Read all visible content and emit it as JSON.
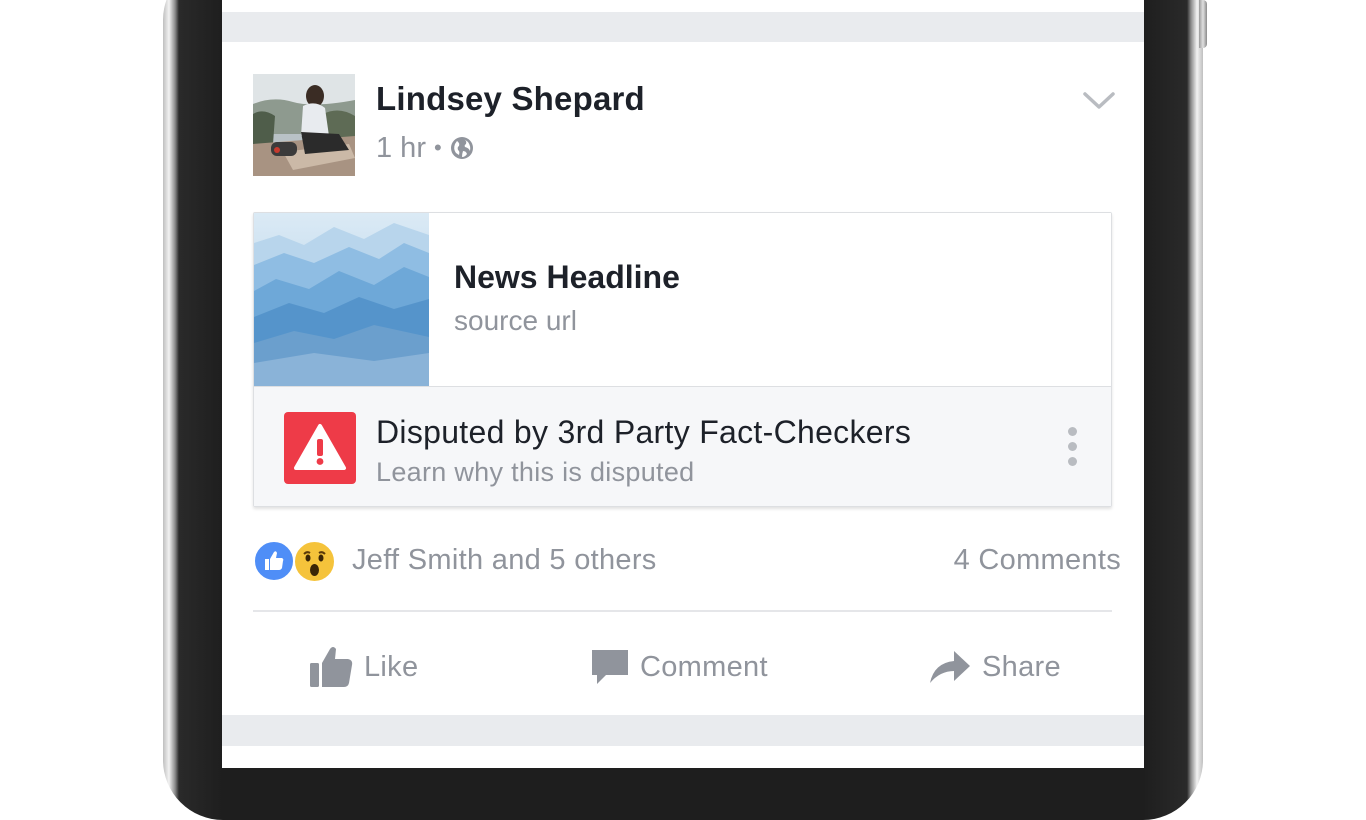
{
  "post": {
    "author": "Lindsey Shepard",
    "time": "1 hr",
    "separator": "•",
    "privacy_icon": "globe-icon",
    "menu_icon": "chevron-down-icon"
  },
  "link": {
    "headline": "News Headline",
    "source": "source url"
  },
  "dispute": {
    "title": "Disputed by 3rd Party Fact-Checkers",
    "subtitle": "Learn why this is disputed",
    "icon": "warning-icon",
    "color": "#ee3b48"
  },
  "reactions": {
    "names": "Jeff Smith and 5 others",
    "comments": "4 Comments",
    "icons": [
      "like-reaction-icon",
      "wow-reaction-icon"
    ]
  },
  "actions": {
    "like": "Like",
    "comment": "Comment",
    "share": "Share"
  },
  "colors": {
    "text_primary": "#1d2129",
    "text_secondary": "#90949c",
    "feed_background": "#e9ebee",
    "like_blue": "#4f8ef7"
  }
}
